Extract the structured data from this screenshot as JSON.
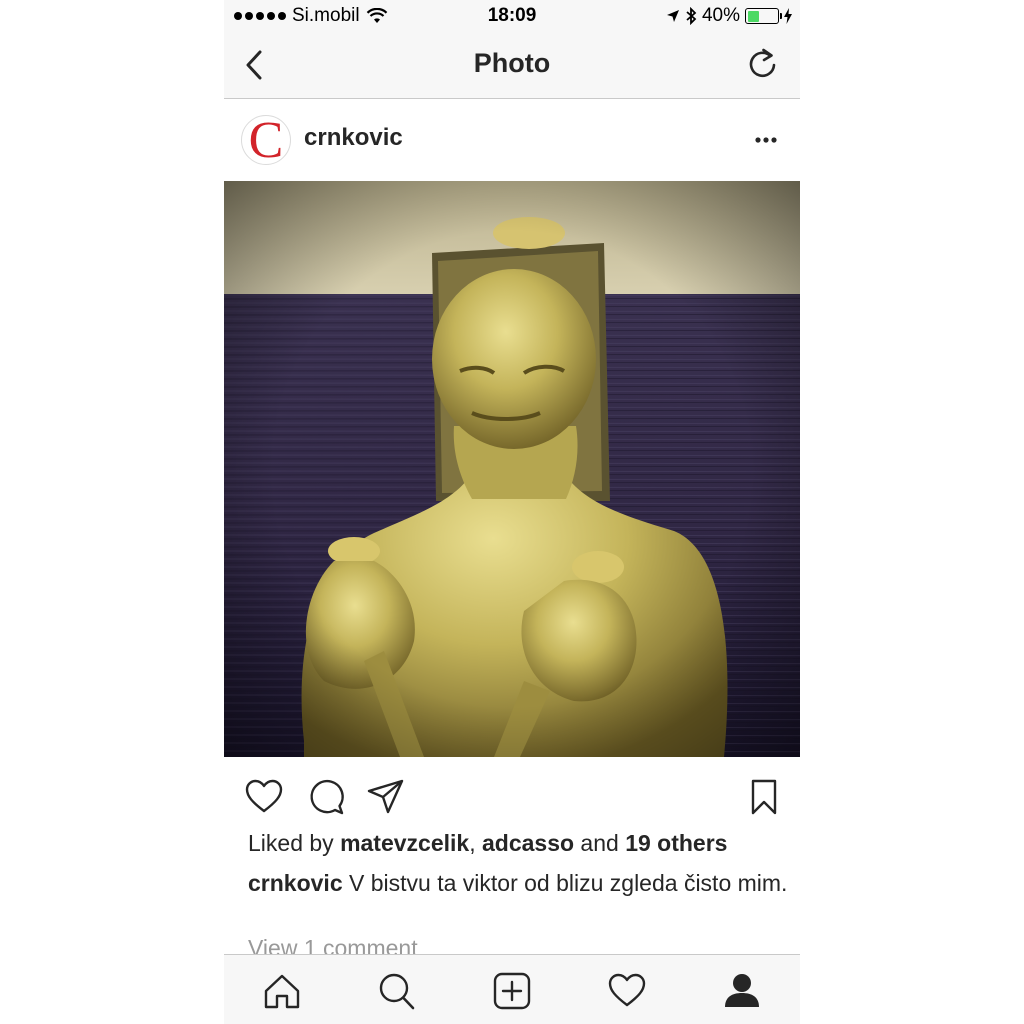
{
  "status_bar": {
    "carrier": "Si.mobil",
    "time": "18:09",
    "battery_percent": "40%",
    "battery_level": 0.4
  },
  "nav": {
    "title": "Photo",
    "back_icon": "chevron-left-icon",
    "refresh_icon": "refresh-icon"
  },
  "post": {
    "username": "crnkovic",
    "avatar_letter": "C",
    "likes": {
      "prefix": "Liked by ",
      "user1": "matevzcelik",
      "sep": ", ",
      "user2": "adcasso",
      "and": " and ",
      "others": "19 others"
    },
    "caption": {
      "username": "crnkovic",
      "text": " V bistvu ta viktor od blizu zgleda čisto mim."
    },
    "view_comments": "View 1 comment"
  },
  "colors": {
    "accent_red": "#d2232a",
    "bar_bg": "#f7f7f7",
    "text": "#262626",
    "muted": "#999999",
    "battery": "#4cd964"
  },
  "tabs": [
    {
      "name": "home",
      "icon": "home-icon"
    },
    {
      "name": "search",
      "icon": "search-icon"
    },
    {
      "name": "add",
      "icon": "add-icon"
    },
    {
      "name": "activity",
      "icon": "heart-icon"
    },
    {
      "name": "profile",
      "icon": "profile-icon"
    }
  ]
}
